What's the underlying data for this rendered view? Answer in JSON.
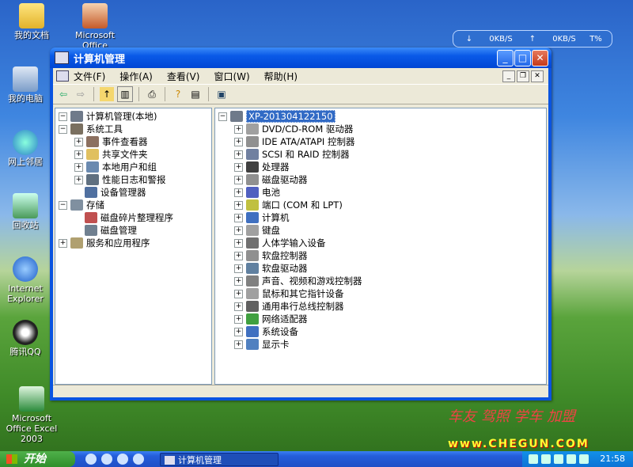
{
  "desktop": {
    "icons": [
      {
        "label": "我的文档",
        "icon": "my-documents-icon"
      },
      {
        "label": "Microsoft Office",
        "icon": "office-icon"
      },
      {
        "label": "我的电脑",
        "icon": "my-computer-icon"
      },
      {
        "label": "网上邻居",
        "icon": "network-icon"
      },
      {
        "label": "回收站",
        "icon": "recycle-bin-icon"
      },
      {
        "label": "Internet Explorer",
        "icon": "ie-icon"
      },
      {
        "label": "腾讯QQ",
        "icon": "qq-icon"
      },
      {
        "label": "Microsoft Office Excel 2003",
        "icon": "excel-icon"
      }
    ],
    "net_meter": {
      "down": "0KB/S",
      "up": "0KB/S",
      "cpu": "T%"
    },
    "watermark": "www.CHEGUN.COM",
    "watermark_script": "车友 驾照 学车 加盟"
  },
  "window": {
    "title": "计算机管理",
    "menu": [
      "文件(F)",
      "操作(A)",
      "查看(V)",
      "窗口(W)",
      "帮助(H)"
    ],
    "tree": [
      {
        "label": "计算机管理(本地)",
        "expander": "−",
        "icon_color": "#6f7a8a"
      },
      {
        "label": "系统工具",
        "expander": "−",
        "icon_color": "#7a7060"
      },
      {
        "label": "事件查看器",
        "expander": "+",
        "icon_color": "#8c7060"
      },
      {
        "label": "共享文件夹",
        "expander": "+",
        "icon_color": "#e0c060"
      },
      {
        "label": "本地用户和组",
        "expander": "+",
        "icon_color": "#6a8ab0"
      },
      {
        "label": "性能日志和警报",
        "expander": "+",
        "icon_color": "#607080"
      },
      {
        "label": "设备管理器",
        "expander": "",
        "icon_color": "#5070a0"
      },
      {
        "label": "存储",
        "expander": "−",
        "icon_color": "#8090a0"
      },
      {
        "label": "磁盘碎片整理程序",
        "expander": "",
        "icon_color": "#c05050"
      },
      {
        "label": "磁盘管理",
        "expander": "",
        "icon_color": "#708090"
      },
      {
        "label": "服务和应用程序",
        "expander": "+",
        "icon_color": "#b0a070"
      }
    ],
    "device_root": "XP-201304122150",
    "devices": [
      {
        "label": "DVD/CD-ROM 驱动器",
        "icon_color": "#a0a0a0"
      },
      {
        "label": "IDE ATA/ATAPI 控制器",
        "icon_color": "#909090"
      },
      {
        "label": "SCSI 和 RAID 控制器",
        "icon_color": "#7080a0"
      },
      {
        "label": "处理器",
        "icon_color": "#404040"
      },
      {
        "label": "磁盘驱动器",
        "icon_color": "#909090"
      },
      {
        "label": "电池",
        "icon_color": "#5060c0"
      },
      {
        "label": "端口 (COM 和 LPT)",
        "icon_color": "#c0c040"
      },
      {
        "label": "计算机",
        "icon_color": "#4070c0"
      },
      {
        "label": "键盘",
        "icon_color": "#a0a0a0"
      },
      {
        "label": "人体学输入设备",
        "icon_color": "#707070"
      },
      {
        "label": "软盘控制器",
        "icon_color": "#909090"
      },
      {
        "label": "软盘驱动器",
        "icon_color": "#6080a0"
      },
      {
        "label": "声音、视频和游戏控制器",
        "icon_color": "#808080"
      },
      {
        "label": "鼠标和其它指针设备",
        "icon_color": "#a0a0a0"
      },
      {
        "label": "通用串行总线控制器",
        "icon_color": "#606060"
      },
      {
        "label": "网络适配器",
        "icon_color": "#40a040"
      },
      {
        "label": "系统设备",
        "icon_color": "#4070c0"
      },
      {
        "label": "显示卡",
        "icon_color": "#5080c0"
      }
    ]
  },
  "taskbar": {
    "start_label": "开始",
    "task_button": "计算机管理",
    "clock": "21:58"
  }
}
